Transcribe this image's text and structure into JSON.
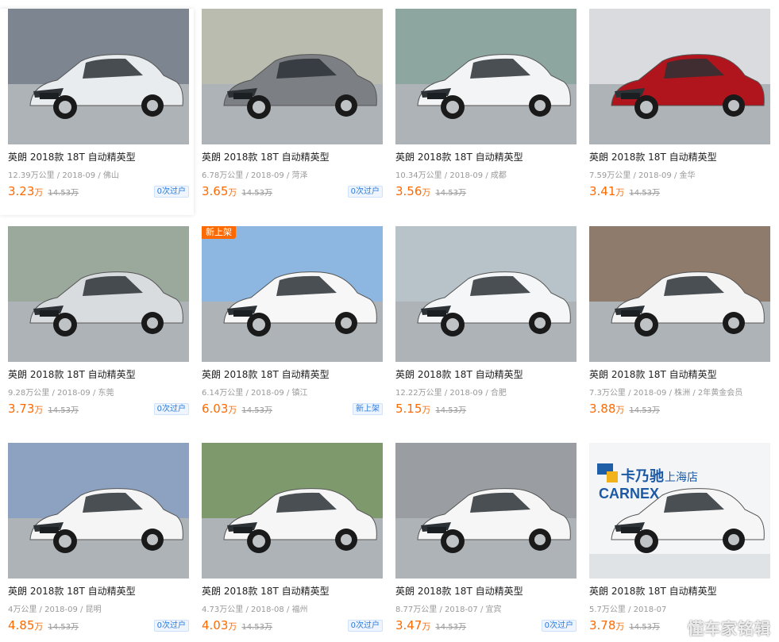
{
  "listings": [
    {
      "title": "英朗 2018款 18T 自动精英型",
      "mileage": "12.39万公里",
      "date": "2018-09",
      "city": "佛山",
      "price": "3.23",
      "unit": "万",
      "orig": "14.53万",
      "badge": "0次过户",
      "tag": "",
      "color": "#e9ecee",
      "bg": "#7d8690"
    },
    {
      "title": "英朗 2018款 18T 自动精英型",
      "mileage": "6.78万公里",
      "date": "2018-09",
      "city": "菏泽",
      "price": "3.65",
      "unit": "万",
      "orig": "14.53万",
      "badge": "0次过户",
      "tag": "",
      "color": "#7c8085",
      "bg": "#b9bcae"
    },
    {
      "title": "英朗 2018款 18T 自动精英型",
      "mileage": "10.34万公里",
      "date": "2018-09",
      "city": "成都",
      "price": "3.56",
      "unit": "万",
      "orig": "14.53万",
      "badge": "",
      "tag": "",
      "color": "#f3f4f5",
      "bg": "#8da7a0"
    },
    {
      "title": "英朗 2018款 18T 自动精英型",
      "mileage": "7.59万公里",
      "date": "2018-09",
      "city": "金华",
      "price": "3.41",
      "unit": "万",
      "orig": "14.53万",
      "badge": "",
      "tag": "",
      "color": "#b0141c",
      "bg": "#d9dbdf"
    },
    {
      "title": "英朗 2018款 18T 自动精英型",
      "mileage": "9.28万公里",
      "date": "2018-09",
      "city": "东莞",
      "price": "3.73",
      "unit": "万",
      "orig": "14.53万",
      "badge": "0次过户",
      "tag": "",
      "color": "#d9dcde",
      "bg": "#9aa99c"
    },
    {
      "title": "英朗 2018款 18T 自动精英型",
      "mileage": "6.14万公里",
      "date": "2018-09",
      "city": "镇江",
      "price": "6.03",
      "unit": "万",
      "orig": "14.53万",
      "badge": "新上架",
      "tag": "新上架",
      "color": "#f7f7f7",
      "bg": "#8db6e0"
    },
    {
      "title": "英朗 2018款 18T 自动精英型",
      "mileage": "12.22万公里",
      "date": "2018-09",
      "city": "合肥",
      "price": "5.15",
      "unit": "万",
      "orig": "14.53万",
      "badge": "",
      "tag": "",
      "color": "#f5f6f7",
      "bg": "#b8c3c9"
    },
    {
      "title": "英朗 2018款 18T 自动精英型",
      "mileage": "7.3万公里",
      "date": "2018-09",
      "city": "株洲",
      "extra": "2年黄金会员",
      "price": "3.88",
      "unit": "万",
      "orig": "14.53万",
      "badge": "",
      "tag": "",
      "color": "#f4f4f4",
      "bg": "#8f7b6b"
    },
    {
      "title": "英朗 2018款 18T 自动精英型",
      "mileage": "4万公里",
      "date": "2018-09",
      "city": "昆明",
      "price": "4.85",
      "unit": "万",
      "orig": "14.53万",
      "badge": "0次过户",
      "tag": "",
      "color": "#f5f5f5",
      "bg": "#8da2c1"
    },
    {
      "title": "英朗 2018款 18T 自动精英型",
      "mileage": "4.73万公里",
      "date": "2018-08",
      "city": "福州",
      "price": "4.03",
      "unit": "万",
      "orig": "14.53万",
      "badge": "0次过户",
      "tag": "",
      "color": "#f6f6f6",
      "bg": "#7e9a6c"
    },
    {
      "title": "英朗 2018款 18T 自动精英型",
      "mileage": "8.77万公里",
      "date": "2018-07",
      "city": "宜宾",
      "price": "3.47",
      "unit": "万",
      "orig": "14.53万",
      "badge": "0次过户",
      "tag": "",
      "color": "#f6f6f6",
      "bg": "#9a9ea2"
    },
    {
      "title": "英朗 2018款 18T 自动精英型",
      "mileage": "5.7万公里",
      "date": "2018-07",
      "city": "",
      "price": "3.78",
      "unit": "万",
      "orig": "14.53万",
      "badge": "",
      "tag": "",
      "color": "#f6f6f6",
      "bg": "#e9ecef",
      "dealer": {
        "logo_cn": "卡乃驰",
        "logo_en": "CARNEX",
        "store": "上海店"
      }
    }
  ],
  "watermark": "懂车家铭辑"
}
